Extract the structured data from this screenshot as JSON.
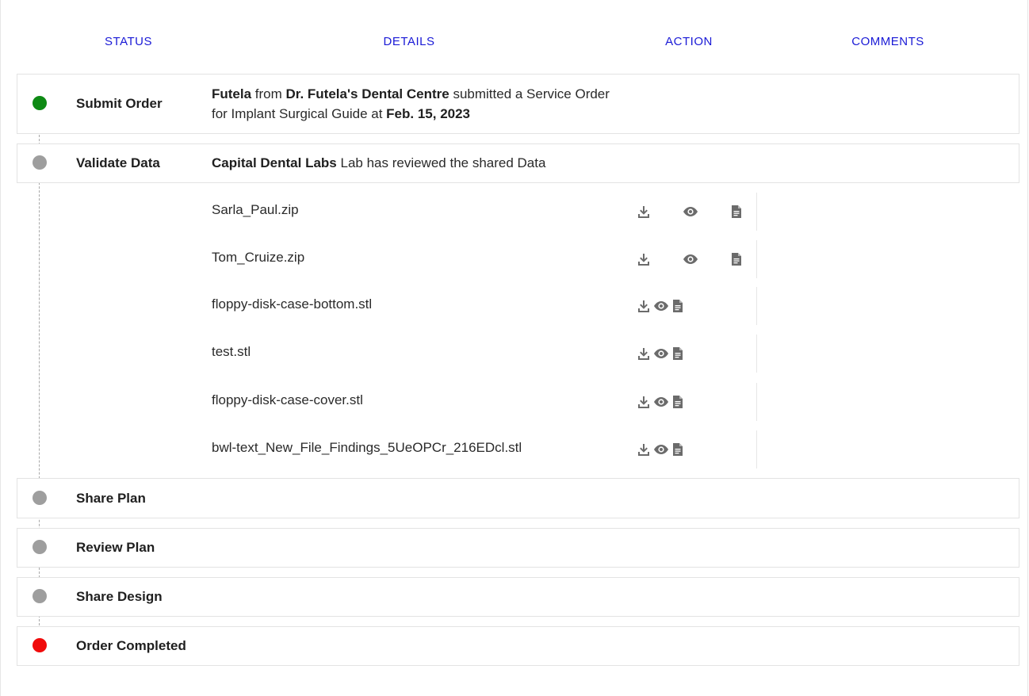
{
  "columns": [
    "STATUS",
    "DETAILS",
    "ACTION",
    "COMMENTS"
  ],
  "colors": {
    "header_text": "#1a1ad6",
    "completed_dot": "#0e8a14",
    "pending_dot": "#9e9e9e",
    "final_dot": "#f00b0b",
    "icon": "#6b6b6b"
  },
  "steps": {
    "submit_order": {
      "label": "Submit Order",
      "user": "Futela",
      "from_word": " from ",
      "clinic": "Dr. Futela's Dental Centre",
      "text_1": " submitted a Service Order",
      "text_2": "for Implant Surgical Guide at ",
      "date": "Feb. 15, 2023"
    },
    "validate_data": {
      "label": "Validate Data",
      "lab": "Capital Dental Labs",
      "text": " Lab has reviewed the shared Data"
    },
    "share_plan": {
      "label": "Share Plan"
    },
    "review_plan": {
      "label": "Review Plan"
    },
    "share_design": {
      "label": "Share Design"
    },
    "order_completed": {
      "label": "Order Completed"
    }
  },
  "files": [
    {
      "name": "Sarla_Paul.zip",
      "actions": [
        "download-icon",
        "eye-icon",
        "document-icon"
      ]
    },
    {
      "name": "Tom_Cruize.zip",
      "actions": [
        "download-icon",
        "eye-icon",
        "document-icon"
      ]
    },
    {
      "name": "floppy-disk-case-bottom.stl",
      "actions": [
        "download-icon",
        "eye-icon",
        "document-icon"
      ]
    },
    {
      "name": "test.stl",
      "actions": [
        "download-icon",
        "eye-icon",
        "document-icon"
      ]
    },
    {
      "name": "floppy-disk-case-cover.stl",
      "actions": [
        "download-icon",
        "eye-icon",
        "document-icon"
      ]
    },
    {
      "name": "bwl-text_New_File_Findings_5UeOPCr_216EDcl.stl",
      "actions": [
        "download-icon",
        "eye-icon",
        "document-icon"
      ]
    }
  ]
}
